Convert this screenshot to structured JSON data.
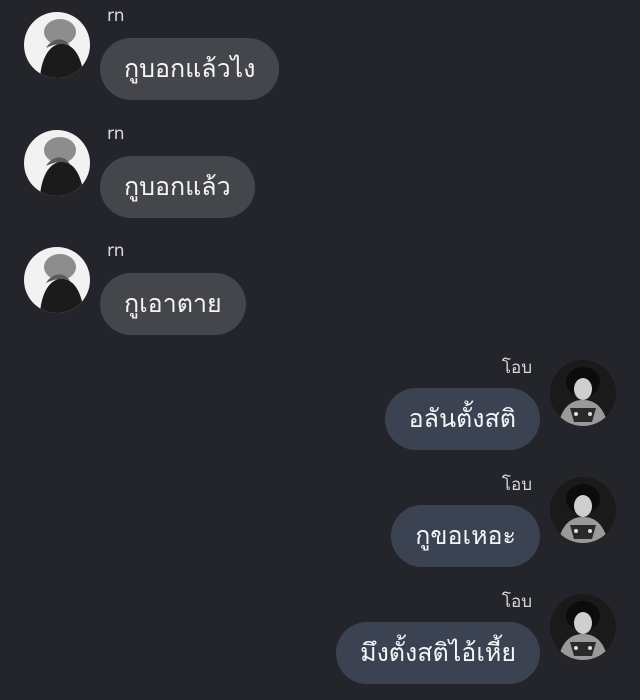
{
  "messages": [
    {
      "sender": "rn",
      "side": "left",
      "text": "กูบอกแล้วไง",
      "avatar": "avatar-rn"
    },
    {
      "sender": "rn",
      "side": "left",
      "text": "กูบอกแล้ว",
      "avatar": "avatar-rn"
    },
    {
      "sender": "rn",
      "side": "left",
      "text": "กูเอาตาย",
      "avatar": "avatar-rn"
    },
    {
      "sender": "โอบ",
      "side": "right",
      "text": "อลันตั้งสติ",
      "avatar": "avatar-oab"
    },
    {
      "sender": "โอบ",
      "side": "right",
      "text": "กูขอเหอะ",
      "avatar": "avatar-oab"
    },
    {
      "sender": "โอบ",
      "side": "right",
      "text": "มึงตั้งสติไอ้เหี้ย",
      "avatar": "avatar-oab"
    }
  ],
  "colors": {
    "background": "#24252b",
    "bubble_left": "#44464c",
    "bubble_right": "#3b4352",
    "text": "#f4f5f7",
    "name": "#d8d9de"
  }
}
